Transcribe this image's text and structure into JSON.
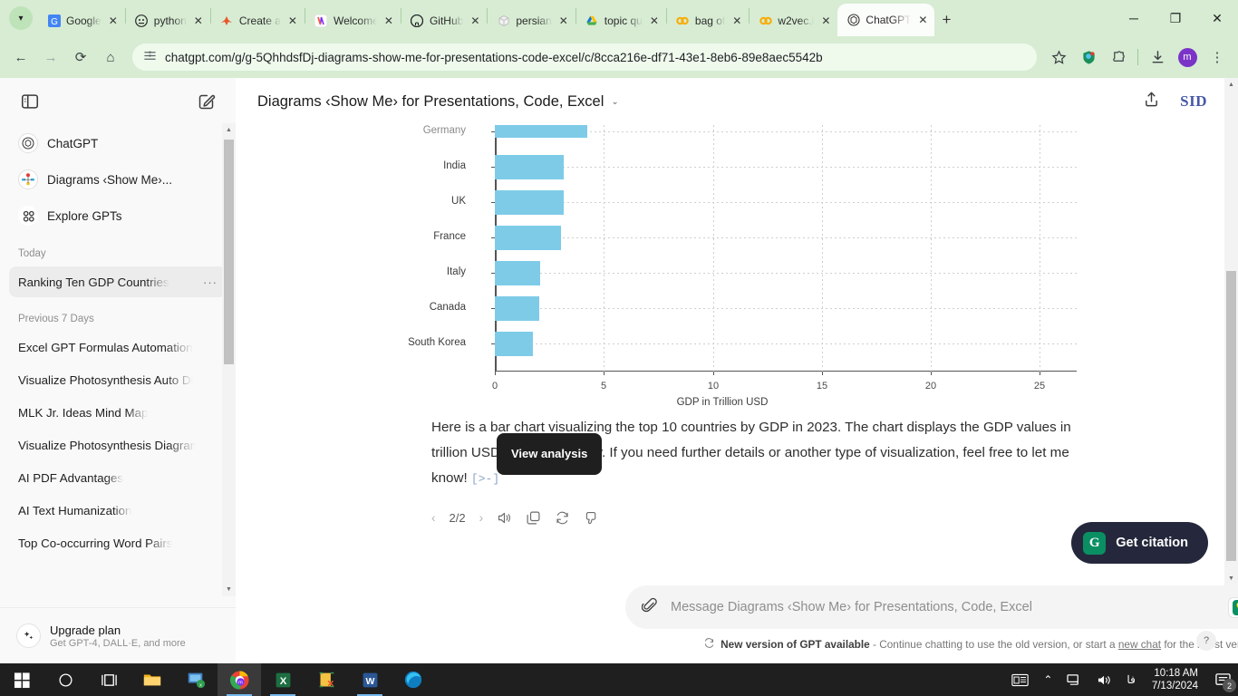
{
  "browser": {
    "tabs": [
      {
        "title": "Google",
        "icon": "google-icon",
        "active": false
      },
      {
        "title": "python",
        "icon": "python-icon",
        "active": false
      },
      {
        "title": "Create a",
        "icon": "matlab-icon",
        "active": false
      },
      {
        "title": "Welcome",
        "icon": "firefox-icon",
        "active": false
      },
      {
        "title": "GitHub",
        "icon": "github-icon",
        "active": false
      },
      {
        "title": "persian",
        "icon": "box-icon",
        "active": false
      },
      {
        "title": "topic qu",
        "icon": "google-drive-icon",
        "active": false
      },
      {
        "title": "bag of",
        "icon": "colab-icon",
        "active": false
      },
      {
        "title": "w2vec.i",
        "icon": "colab-icon",
        "active": false
      },
      {
        "title": "ChatGPT",
        "icon": "openai-icon",
        "active": true
      }
    ],
    "new_tab_label": "+",
    "close_label": "✕",
    "window_minimize": "─",
    "window_restore": "❐",
    "window_close": "✕",
    "nav": {
      "back": "←",
      "forward": "→",
      "reload": "⟳",
      "home": "⌂"
    },
    "url": "chatgpt.com/g/g-5QhhdsfDj-diagrams-show-me-for-presentations-code-excel/c/8cca216e-df71-43e1-8eb6-89e8aec5542b",
    "site_info_icon": "site-settings-icon",
    "toolbar_icons": [
      "bookmark-star-icon",
      "shield-extension-icon",
      "puzzle-extension-icon",
      "downloads-icon"
    ],
    "profile_initial": "m",
    "menu_icon": "⋮"
  },
  "sidebar": {
    "toggle_icon": "sidebar-toggle-icon",
    "new_chat_icon": "new-chat-icon",
    "items": [
      {
        "label": "ChatGPT",
        "icon": "openai-logo-icon"
      },
      {
        "label": "Diagrams ‹Show Me›...",
        "icon": "diagrams-gpt-icon"
      },
      {
        "label": "Explore GPTs",
        "icon": "explore-gpts-icon"
      }
    ],
    "sections": [
      {
        "title": "Today",
        "chats": [
          {
            "label": "Ranking Ten GDP Countries",
            "active": true,
            "menu": "···"
          }
        ]
      },
      {
        "title": "Previous 7 Days",
        "chats": [
          {
            "label": "Excel GPT Formulas Automation",
            "active": false
          },
          {
            "label": "Visualize Photosynthesis Auto Di",
            "active": false
          },
          {
            "label": "MLK Jr. Ideas Mind Map",
            "active": false
          },
          {
            "label": "Visualize Photosynthesis Diagram",
            "active": false
          },
          {
            "label": "AI PDF Advantages",
            "active": false
          },
          {
            "label": "AI Text Humanization",
            "active": false
          },
          {
            "label": "Top Co-occurring Word Pairs",
            "active": false
          }
        ]
      }
    ],
    "upgrade": {
      "title": "Upgrade plan",
      "subtitle": "Get GPT-4, DALL·E, and more",
      "icon": "sparkle-icon"
    }
  },
  "header": {
    "title": "Diagrams ‹Show Me› for Presentations, Code, Excel",
    "chevron": "⌄",
    "share_icon": "share-upload-icon",
    "avatar_initials": "SID"
  },
  "chart_data": {
    "type": "bar",
    "orientation": "horizontal",
    "title": "",
    "xlabel": "GDP in Trillion USD",
    "ylabel": "",
    "categories": [
      "Germany",
      "India",
      "UK",
      "France",
      "Italy",
      "Canada",
      "South Korea"
    ],
    "values": [
      4.25,
      3.17,
      3.17,
      3.05,
      2.08,
      2.04,
      1.75
    ],
    "xticks": [
      0,
      5,
      10,
      15,
      20,
      25
    ],
    "xlim": [
      0,
      26.5
    ],
    "bar_color": "#7ecbe8",
    "grid": true,
    "legend": false,
    "note": "Top of chart is scrolled out of view; Germany bar is clipped. Chart shows top 10 countries by GDP 2023; only 7 categories visible."
  },
  "message": {
    "paragraph": "Here is a bar chart visualizing the top 10 countries by GDP in 2023. The chart displays the GDP values in trillion USD for each country. If you need further details or another type of visualization, feel free to let me know!",
    "code_pill": "[>-]",
    "tooltip": "View analysis",
    "actions": {
      "prev": "‹",
      "page": "2/2",
      "next": "›",
      "read_aloud": "speaker-icon",
      "copy": "copy-icon",
      "regenerate": "regenerate-icon",
      "dislike": "thumbs-down-icon"
    }
  },
  "citation": {
    "label": "Get citation",
    "badge": "G",
    "badge_color": "#0a8f63",
    "background": "#25283c"
  },
  "composer": {
    "attach_icon": "paperclip-icon",
    "placeholder": "Message Diagrams ‹Show Me› for Presentations, Code, Excel",
    "ext_icons": [
      "bulb-extension-icon",
      "grammarly-icon"
    ],
    "send_icon": "↑"
  },
  "footer": {
    "refresh_icon": "refresh-icon",
    "bold_text": "New version of GPT available",
    "text_before": " - Continue chatting to use the old version, or start a ",
    "link": "new chat",
    "text_after": " for the latest version.",
    "help_label": "?"
  },
  "taskbar": {
    "apps": [
      {
        "name": "start-button",
        "icon": "windows-logo"
      },
      {
        "name": "search-button",
        "icon": "circle"
      },
      {
        "name": "task-view-button",
        "icon": "task-view"
      },
      {
        "name": "file-explorer",
        "icon": "folder"
      },
      {
        "name": "remote-desktop",
        "icon": "monitor"
      },
      {
        "name": "google-chrome",
        "icon": "chrome"
      },
      {
        "name": "microsoft-excel",
        "icon": "excel"
      },
      {
        "name": "app-seven",
        "icon": "sticky"
      },
      {
        "name": "microsoft-word",
        "icon": "word"
      },
      {
        "name": "microsoft-edge",
        "icon": "edge"
      }
    ],
    "tray": {
      "news_icon": "news-weather-icon",
      "chevron": "⌃",
      "network_icon": "network-icon",
      "volume_icon": "volume-icon",
      "language": "فا",
      "time": "10:18 AM",
      "date": "7/13/2024",
      "notification_count": "2"
    }
  }
}
